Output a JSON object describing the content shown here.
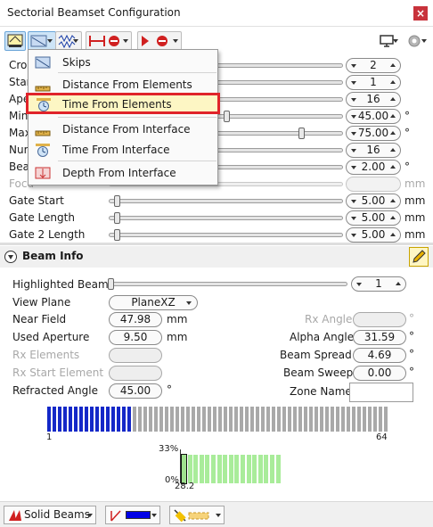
{
  "window": {
    "title": "Sectorial Beamset Configuration",
    "close_label": "×"
  },
  "toolbar": {
    "icons": [
      "beam-config-icon",
      "skip-mode-icon",
      "waveform-icon",
      "aperture-icon",
      "focus-icon",
      "display-icon",
      "settings-gear-icon"
    ]
  },
  "rows": [
    {
      "label": "Crop",
      "value": "2",
      "unit": "",
      "fill": 0.1,
      "disabled": false
    },
    {
      "label": "Star",
      "value": "1",
      "unit": "",
      "fill": 0.1,
      "disabled": false
    },
    {
      "label": "Ape",
      "value": "16",
      "unit": "",
      "fill": 0.1,
      "disabled": false
    },
    {
      "label": "Min",
      "value": "45.00",
      "unit": "°",
      "fill": 0.5,
      "disabled": false
    },
    {
      "label": "Max",
      "value": "75.00",
      "unit": "°",
      "fill": 0.83,
      "disabled": false
    },
    {
      "label": "Num",
      "value": "16",
      "unit": "",
      "fill": 0.1,
      "disabled": false
    },
    {
      "label": "Bear",
      "value": "2.00",
      "unit": "°",
      "fill": 0.1,
      "disabled": false
    },
    {
      "label": "Focu",
      "value": "",
      "unit": "mm",
      "fill": 0,
      "disabled": true
    },
    {
      "label": "Gate Start",
      "value": "5.00",
      "unit": "mm",
      "fill": 0.02,
      "disabled": false
    },
    {
      "label": "Gate Length",
      "value": "5.00",
      "unit": "mm",
      "fill": 0.02,
      "disabled": false
    },
    {
      "label": "Gate 2 Length",
      "value": "5.00",
      "unit": "mm",
      "fill": 0.02,
      "disabled": false
    }
  ],
  "menu": {
    "items": [
      {
        "label": "Skips",
        "icon": "skips-icon",
        "highlighted": false
      },
      {
        "label": "Distance From Elements",
        "icon": "ruler-icon",
        "highlighted": false
      },
      {
        "label": "Time From Elements",
        "icon": "clock-icon",
        "highlighted": true
      },
      {
        "label": "Distance From Interface",
        "icon": "ruler-icon",
        "highlighted": false
      },
      {
        "label": "Time From Interface",
        "icon": "clock-icon",
        "highlighted": false
      },
      {
        "label": "Depth From Interface",
        "icon": "depth-icon",
        "highlighted": false
      }
    ]
  },
  "beam_info": {
    "title": "Beam Info",
    "highlighted_beam_label": "Highlighted Beam",
    "highlighted_beam_value": "1",
    "view_plane_label": "View Plane",
    "view_plane_value": "PlaneXZ",
    "near_field_label": "Near Field",
    "near_field_value": "47.98",
    "near_field_unit": "mm",
    "used_aperture_label": "Used Aperture",
    "used_aperture_value": "9.50",
    "used_aperture_unit": "mm",
    "rx_elements_label": "Rx Elements",
    "rx_start_element_label": "Rx Start Element",
    "refracted_angle_label": "Refracted Angle",
    "refracted_angle_value": "45.00",
    "refracted_angle_unit": "°",
    "rx_angle_label": "Rx Angle",
    "rx_angle_unit": "°",
    "alpha_angle_label": "Alpha Angle",
    "alpha_angle_value": "31.59",
    "alpha_angle_unit": "°",
    "beam_spread_label": "Beam Spread",
    "beam_spread_value": "4.69",
    "beam_spread_unit": "°",
    "beam_sweep_label": "Beam Sweep",
    "beam_sweep_value": "0.00",
    "beam_sweep_unit": "°",
    "zone_name_label": "Zone Name",
    "zone_name_value": ""
  },
  "elements": {
    "total": 64,
    "active": 16,
    "active_color": "#1428c8",
    "inactive_color": "#a9a9a9",
    "start_label": "1",
    "end_label": "64"
  },
  "histogram": {
    "top_label": "33%",
    "bottom_label": "0%",
    "x_label": "28.2",
    "values": [
      0.9,
      0.9,
      0.9,
      0.9,
      0.9,
      0.9,
      0.9,
      0.9,
      0.9,
      0.9,
      0.9,
      0.9,
      0.9,
      0.9,
      0.9,
      0.9,
      0.9
    ]
  },
  "bottom": {
    "solid_beams_label": "Solid Beams",
    "line_color": "#0000e6"
  }
}
